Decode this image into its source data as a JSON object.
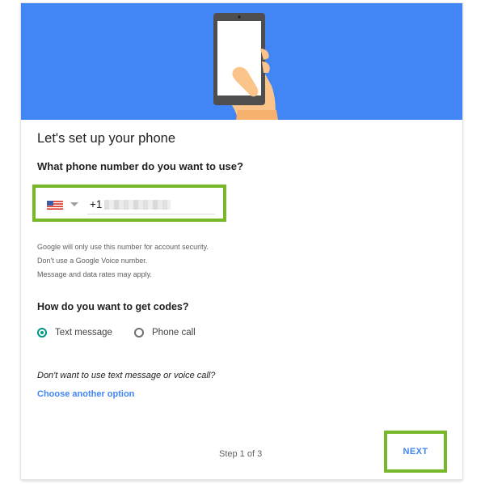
{
  "header": {
    "illustration": "hand-holding-phone"
  },
  "page": {
    "title": "Let's set up your phone",
    "phone_question": "What phone number do you want to use?"
  },
  "phone_input": {
    "country_flag": "us-flag-icon",
    "country_code": "+1",
    "number": "redacted"
  },
  "notice": [
    "Google will only use this number for account security.",
    "Don't use a Google Voice number.",
    "Message and data rates may apply."
  ],
  "codes": {
    "question": "How do you want to get codes?",
    "options": [
      {
        "label": "Text message",
        "selected": true
      },
      {
        "label": "Phone call",
        "selected": false
      }
    ]
  },
  "alternative": {
    "question": "Don't want to use text message or voice call?",
    "link": "Choose another option"
  },
  "footer": {
    "step": "Step 1 of 3",
    "next": "NEXT"
  },
  "colors": {
    "hero_blue": "#4285f4",
    "radio_teal": "#009688",
    "link_blue": "#4285f4",
    "highlight_green": "#76b82a"
  }
}
